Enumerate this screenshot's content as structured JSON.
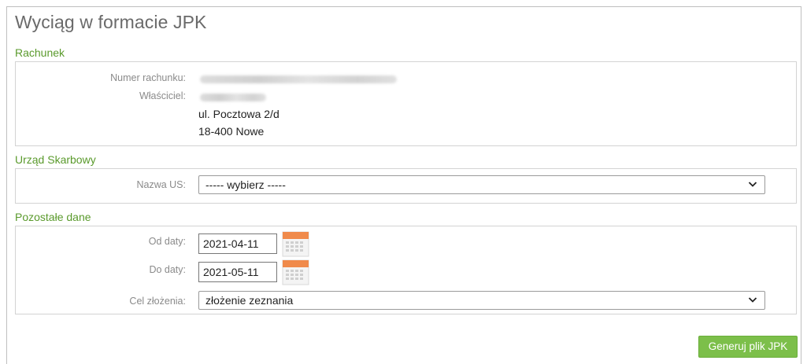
{
  "page": {
    "title": "Wyciąg w formacie JPK"
  },
  "rachunek": {
    "section_title": "Rachunek",
    "account_number_label": "Numer rachunku:",
    "owner_label": "Właściciel:",
    "address_line1": "ul. Pocztowa 2/d",
    "address_line2": "18-400 Nowe"
  },
  "urzad": {
    "section_title": "Urząd Skarbowy",
    "name_label": "Nazwa US:",
    "name_selected": "----- wybierz -----"
  },
  "pozostale": {
    "section_title": "Pozostałe dane",
    "from_label": "Od daty:",
    "from_value": "2021-04-11",
    "to_label": "Do daty:",
    "to_value": "2021-05-11",
    "purpose_label": "Cel złożenia:",
    "purpose_selected": "złożenie zeznania"
  },
  "actions": {
    "generate_label": "Generuj plik JPK"
  },
  "colors": {
    "accent_green": "#5a9a2c",
    "button_green": "#7cbf4a",
    "calendar_orange": "#f08a4b"
  },
  "icons": {
    "select_arrow": "chevron-down-icon",
    "date_picker": "calendar-icon"
  }
}
